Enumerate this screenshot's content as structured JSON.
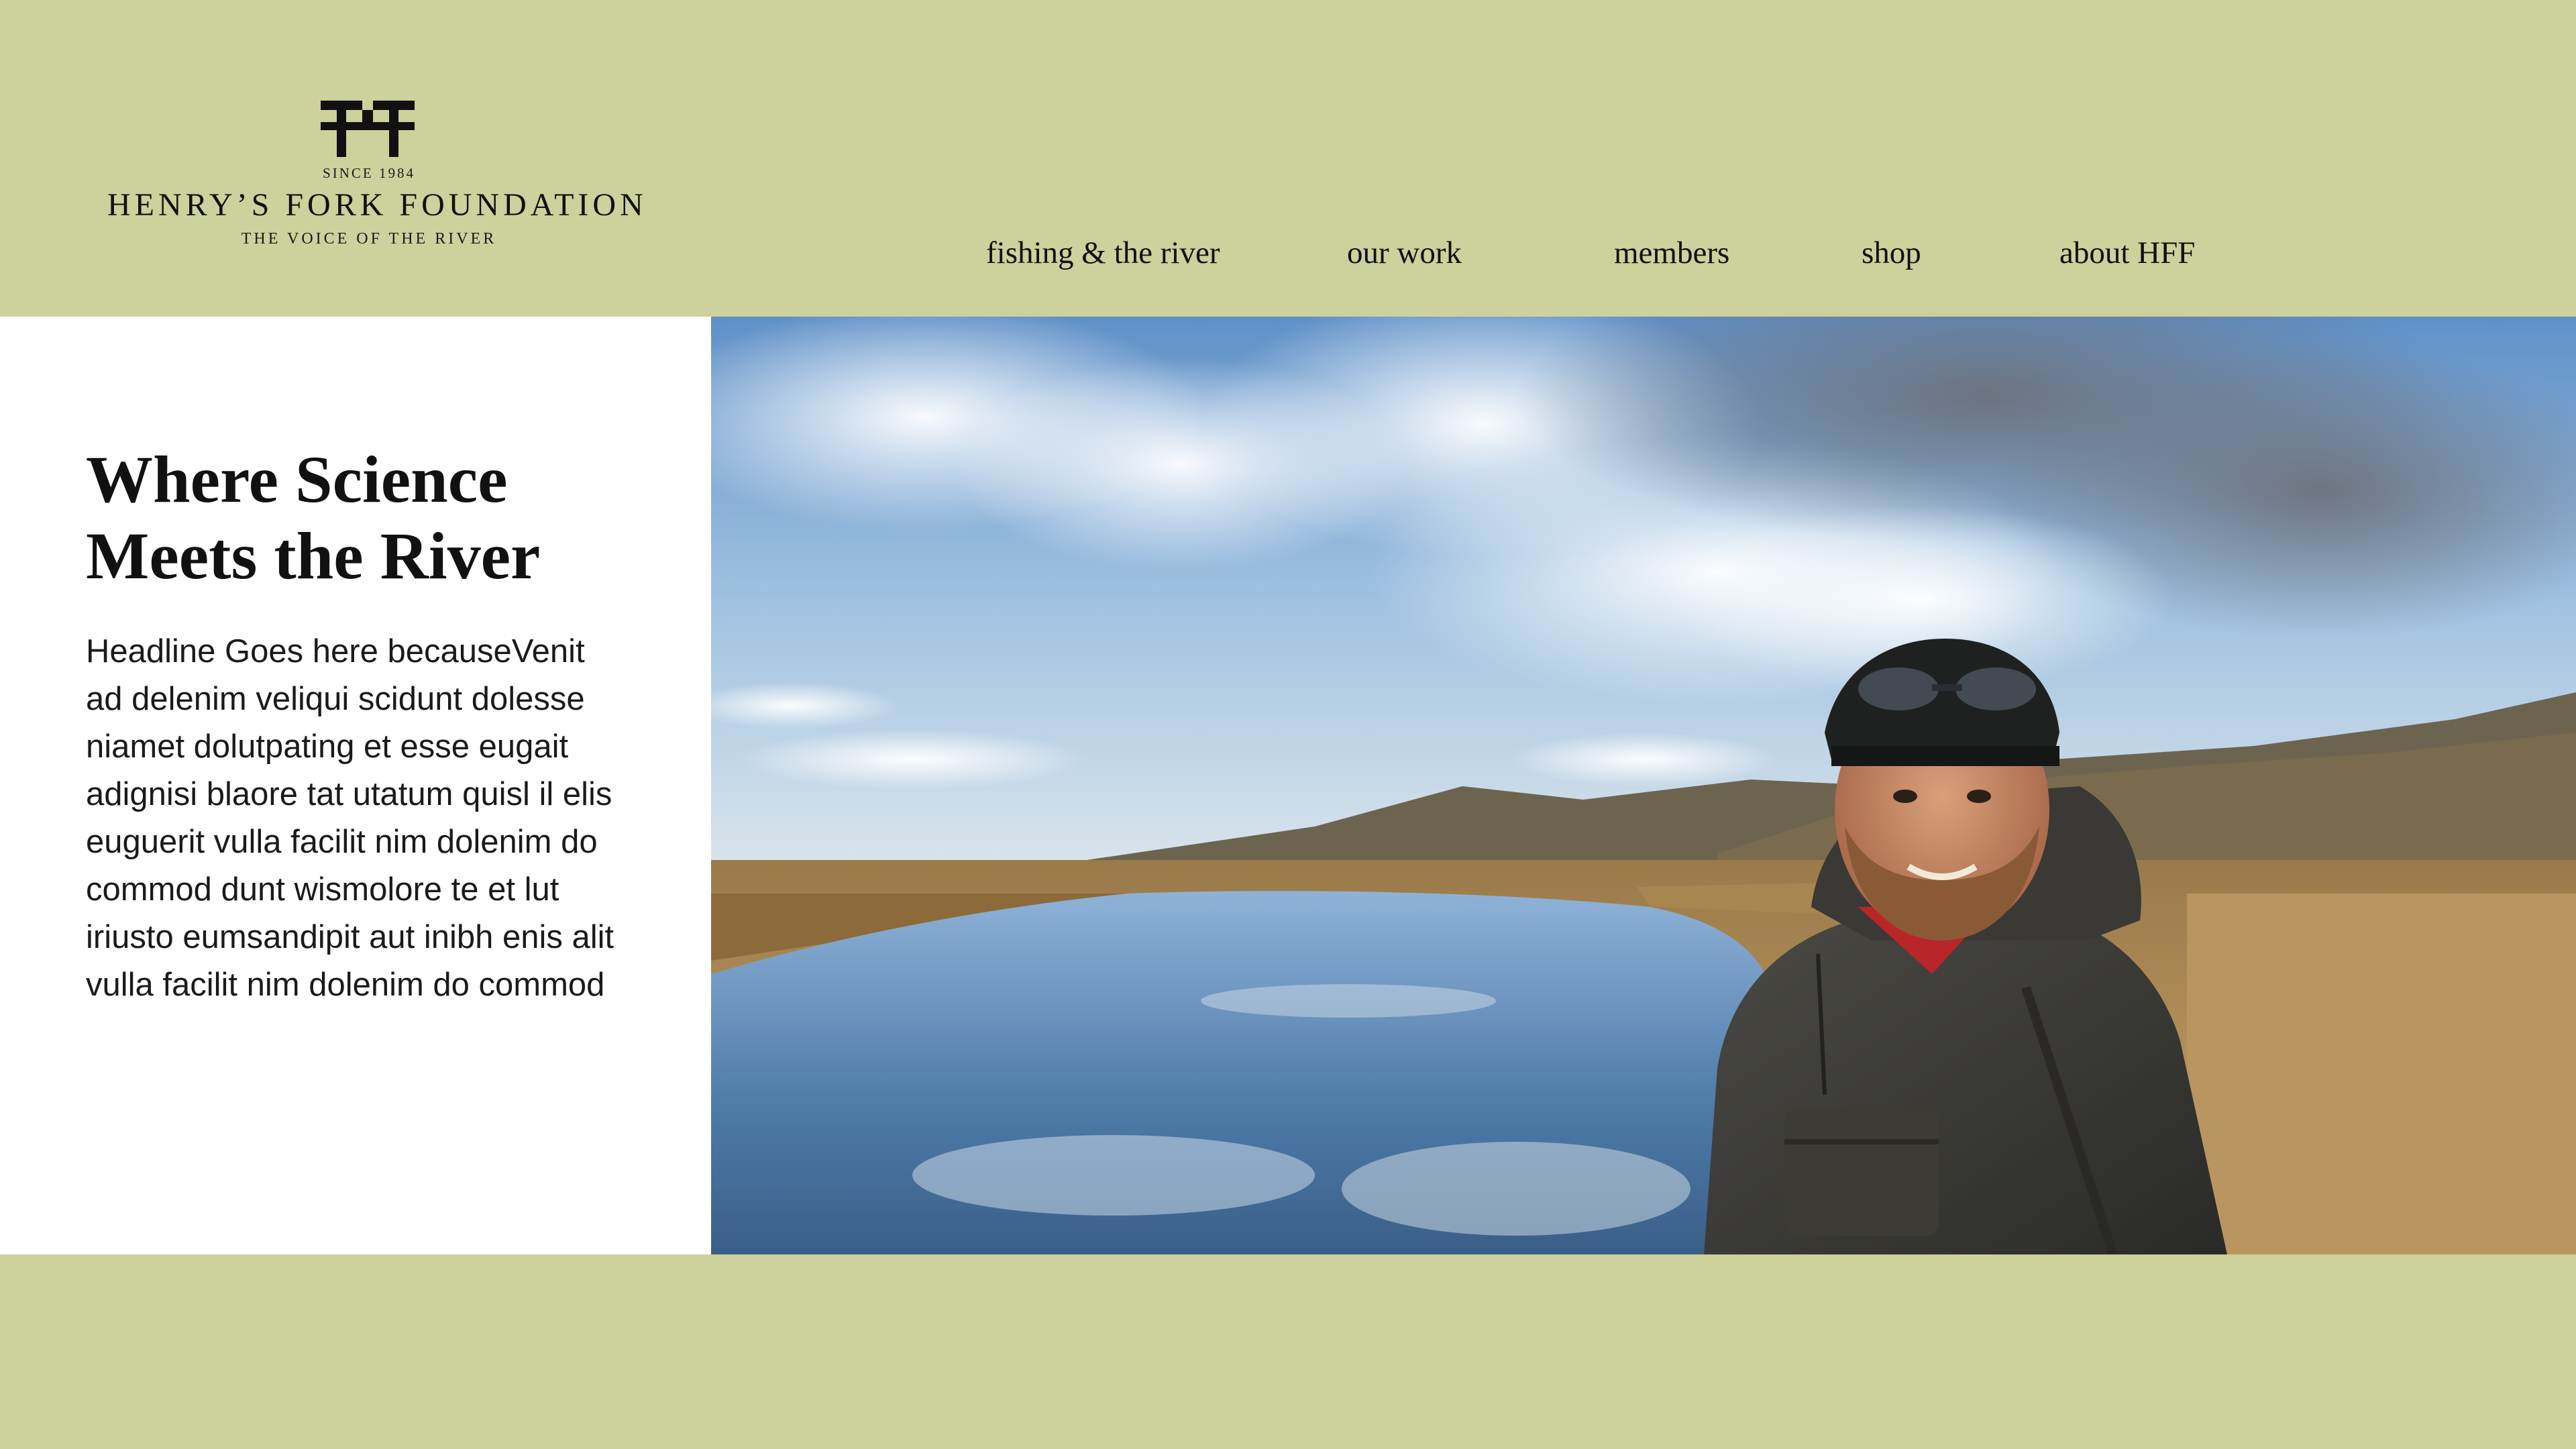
{
  "logo": {
    "mark_alt": "HFF monogram",
    "since": "SINCE 1984",
    "name": "HENRY’S FORK FOUNDATION",
    "tagline": "THE VOICE OF THE RIVER"
  },
  "nav": {
    "items": [
      {
        "label": "fishing & the river"
      },
      {
        "label": "our work"
      },
      {
        "label": "members"
      },
      {
        "label": "shop"
      },
      {
        "label": "about HFF"
      }
    ]
  },
  "hero": {
    "title_line1": "Where Science",
    "title_line2": "Meets the River",
    "body_lines": [
      "Headline Goes here becauseVenit",
      "ad delenim veliqui scidunt dolesse",
      "niamet dolutpating et esse eugait",
      "adignisi blaore tat utatum quisl il elis",
      "euguerit vulla facilit nim dolenim do",
      "commod dunt wismolore te et lut",
      "iriusto eumsandipit aut inibh enis alit",
      "vulla facilit nim dolenim do commod"
    ],
    "photo_alt": "Smiling angler in a rain jacket and cap standing beside a calm river under a cloudy sky"
  },
  "colors": {
    "brand_green": "#cdd19b",
    "text": "#111111",
    "panel": "#ffffff"
  }
}
